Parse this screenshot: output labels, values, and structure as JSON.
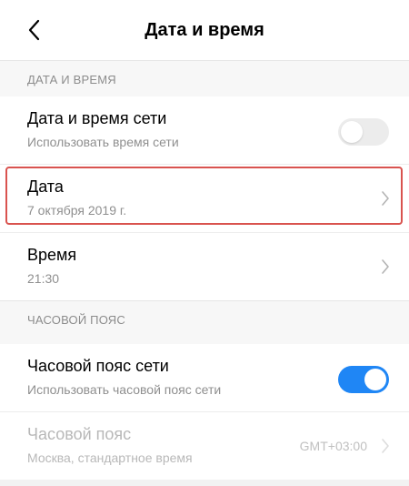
{
  "header": {
    "title": "Дата и время",
    "back_icon": "chevron-left-icon"
  },
  "sections": {
    "datetime": {
      "header": "ДАТА И ВРЕМЯ",
      "network_time": {
        "title": "Дата и время сети",
        "subtitle": "Использовать время сети",
        "enabled": false
      },
      "date": {
        "title": "Дата",
        "value": "7 октября 2019 г."
      },
      "time": {
        "title": "Время",
        "value": "21:30"
      }
    },
    "timezone": {
      "header": "ЧАСОВОЙ ПОЯС",
      "network_timezone": {
        "title": "Часовой пояс сети",
        "subtitle": "Использовать часовой пояс сети",
        "enabled": true
      },
      "timezone_row": {
        "title": "Часовой пояс",
        "subtitle": "Москва, стандартное время",
        "value": "GMT+03:00",
        "disabled": true
      }
    }
  },
  "colors": {
    "accent": "#1f86f5",
    "highlight_border": "#d9534f",
    "muted_text": "#8f8f8f"
  }
}
